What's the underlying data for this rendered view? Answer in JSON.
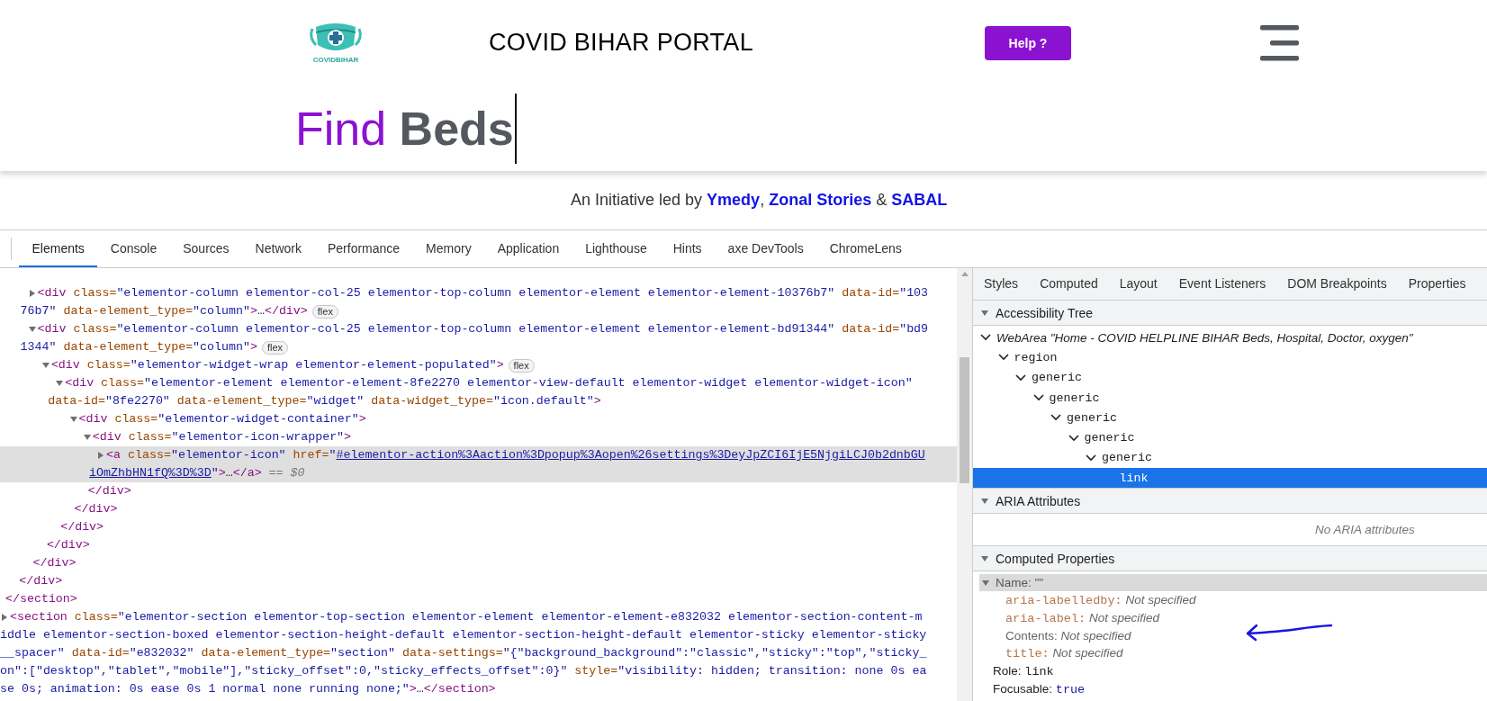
{
  "page": {
    "logo_text": "COVIDBIHAR",
    "title": "COVID BIHAR PORTAL",
    "help_button": "Help ?",
    "heading": [
      {
        "kind": "accent",
        "text": "Find"
      },
      {
        "kind": "main",
        "text": "Beds"
      }
    ],
    "credit": "An Initiative led by **Ymedy**, **Zonal Stories** & **SABAL**"
  },
  "devtools": {
    "tabs": [
      {
        "label": "Elements",
        "selected": true
      },
      {
        "label": "Console",
        "selected": false
      },
      {
        "label": "Sources",
        "selected": false
      },
      {
        "label": "Network",
        "selected": false
      },
      {
        "label": "Performance",
        "selected": false
      },
      {
        "label": "Memory",
        "selected": false
      },
      {
        "label": "Application",
        "selected": false
      },
      {
        "label": "Lighthouse",
        "selected": false
      },
      {
        "label": "Hints",
        "selected": false
      },
      {
        "label": "axe DevTools",
        "selected": false
      },
      {
        "label": "ChromeLens",
        "selected": false
      }
    ],
    "dom_tree": [
      {
        "children": [
          {
            "children": [
              {
                "expanded": false,
                "selected": false,
                "lines": [
                  [
                    {
                      "kind": "tag",
                      "text": "<div"
                    },
                    {
                      "kind": "attr",
                      "text": " class="
                    },
                    {
                      "kind": "value",
                      "text": "\"elementor-column elementor-col-25 elementor-top-column elementor-element elementor-element-10376b7\""
                    },
                    {
                      "kind": "attr",
                      "text": " data-id="
                    },
                    {
                      "kind": "value",
                      "text": "\"103"
                    }
                  ],
                  [
                    {
                      "kind": "value",
                      "text": "76b7\""
                    },
                    {
                      "kind": "attr",
                      "text": " data-element_type="
                    },
                    {
                      "kind": "value",
                      "text": "\"column\""
                    },
                    {
                      "kind": "tag",
                      "text": ">"
                    },
                    {
                      "kind": "text",
                      "text": "…"
                    },
                    {
                      "kind": "tag",
                      "text": "</div>"
                    },
                    {
                      "kind": "badge",
                      "text": "flex"
                    }
                  ]
                ]
              },
              {
                "expanded": true,
                "selected": false,
                "lines": [
                  [
                    {
                      "kind": "tag",
                      "text": "<div"
                    },
                    {
                      "kind": "attr",
                      "text": " class="
                    },
                    {
                      "kind": "value",
                      "text": "\"elementor-column elementor-col-25 elementor-top-column elementor-element elementor-element-bd91344\""
                    },
                    {
                      "kind": "attr",
                      "text": " data-id="
                    },
                    {
                      "kind": "value",
                      "text": "\"bd9"
                    }
                  ],
                  [
                    {
                      "kind": "value",
                      "text": "1344\""
                    },
                    {
                      "kind": "attr",
                      "text": " data-element_type="
                    },
                    {
                      "kind": "value",
                      "text": "\"column\""
                    },
                    {
                      "kind": "tag",
                      "text": ">"
                    },
                    {
                      "kind": "badge",
                      "text": "flex"
                    }
                  ]
                ],
                "children": [
                  {
                    "expanded": true,
                    "selected": false,
                    "lines": [
                      [
                        {
                          "kind": "tag",
                          "text": "<div"
                        },
                        {
                          "kind": "attr",
                          "text": " class="
                        },
                        {
                          "kind": "value",
                          "text": "\"elementor-widget-wrap elementor-element-populated\""
                        },
                        {
                          "kind": "tag",
                          "text": ">"
                        },
                        {
                          "kind": "badge",
                          "text": "flex"
                        }
                      ]
                    ],
                    "children": [
                      {
                        "expanded": true,
                        "selected": false,
                        "lines": [
                          [
                            {
                              "kind": "tag",
                              "text": "<div"
                            },
                            {
                              "kind": "attr",
                              "text": " class="
                            },
                            {
                              "kind": "value",
                              "text": "\"elementor-element elementor-element-8fe2270 elementor-view-default elementor-widget elementor-widget-icon\""
                            }
                          ],
                          [
                            {
                              "kind": "attr",
                              "text": "data-id="
                            },
                            {
                              "kind": "value",
                              "text": "\"8fe2270\""
                            },
                            {
                              "kind": "attr",
                              "text": " data-element_type="
                            },
                            {
                              "kind": "value",
                              "text": "\"widget\""
                            },
                            {
                              "kind": "attr",
                              "text": " data-widget_type="
                            },
                            {
                              "kind": "value",
                              "text": "\"icon.default\""
                            },
                            {
                              "kind": "tag",
                              "text": ">"
                            }
                          ]
                        ],
                        "children": [
                          {
                            "expanded": true,
                            "selected": false,
                            "lines": [
                              [
                                {
                                  "kind": "tag",
                                  "text": "<div"
                                },
                                {
                                  "kind": "attr",
                                  "text": " class="
                                },
                                {
                                  "kind": "value",
                                  "text": "\"elementor-widget-container\""
                                },
                                {
                                  "kind": "tag",
                                  "text": ">"
                                }
                              ]
                            ],
                            "children": [
                              {
                                "expanded": true,
                                "selected": false,
                                "lines": [
                                  [
                                    {
                                      "kind": "tag",
                                      "text": "<div"
                                    },
                                    {
                                      "kind": "attr",
                                      "text": " class="
                                    },
                                    {
                                      "kind": "value",
                                      "text": "\"elementor-icon-wrapper\""
                                    },
                                    {
                                      "kind": "tag",
                                      "text": ">"
                                    }
                                  ]
                                ],
                                "children": [
                                  {
                                    "expanded": false,
                                    "selected": true,
                                    "lines": [
                                      [
                                        {
                                          "kind": "tag",
                                          "text": "<a"
                                        },
                                        {
                                          "kind": "attr",
                                          "text": " class="
                                        },
                                        {
                                          "kind": "value",
                                          "text": "\"elementor-icon\""
                                        },
                                        {
                                          "kind": "attr",
                                          "text": " href="
                                        },
                                        {
                                          "kind": "value",
                                          "text": "\""
                                        },
                                        {
                                          "kind": "link",
                                          "text": "#elementor-action%3Aaction%3Dpopup%3Aopen%26settings%3DeyJpZCI6IjE5NjgiLCJ0b2dnbGU"
                                        }
                                      ],
                                      [
                                        {
                                          "kind": "link",
                                          "text": "iOmZhbHN1fQ%3D%3D"
                                        },
                                        {
                                          "kind": "value",
                                          "text": "\""
                                        },
                                        {
                                          "kind": "tag",
                                          "text": ">"
                                        },
                                        {
                                          "kind": "text",
                                          "text": "…"
                                        },
                                        {
                                          "kind": "tag",
                                          "text": "</a>"
                                        },
                                        {
                                          "kind": "dim",
                                          "text": " == $0"
                                        }
                                      ]
                                    ]
                                  }
                                ],
                                "close": [
                                  {
                                    "kind": "tag",
                                    "text": "</div>"
                                  }
                                ]
                              }
                            ],
                            "close": [
                              {
                                "kind": "tag",
                                "text": "</div>"
                              }
                            ]
                          }
                        ],
                        "close": [
                          {
                            "kind": "tag",
                            "text": "</div>"
                          }
                        ]
                      }
                    ],
                    "close": [
                      {
                        "kind": "tag",
                        "text": "</div>"
                      }
                    ]
                  }
                ],
                "close": [
                  {
                    "kind": "tag",
                    "text": "</div>"
                  }
                ]
              }
            ],
            "close": [
              {
                "kind": "tag",
                "text": "</div>"
              }
            ]
          }
        ],
        "close": [
          {
            "kind": "tag",
            "text": "</section>"
          }
        ]
      },
      {
        "expanded": false,
        "selected": false,
        "lines": [
          [
            {
              "kind": "tag",
              "text": "<section"
            },
            {
              "kind": "attr",
              "text": " class="
            },
            {
              "kind": "value",
              "text": "\"elementor-section elementor-top-section elementor-element elementor-element-e832032 elementor-section-content-m"
            }
          ],
          [
            {
              "kind": "value",
              "text": "iddle elementor-section-boxed elementor-section-height-default elementor-section-height-default elementor-sticky elementor-sticky"
            }
          ],
          [
            {
              "kind": "value",
              "text": "__spacer\""
            },
            {
              "kind": "attr",
              "text": " data-id="
            },
            {
              "kind": "value",
              "text": "\"e832032\""
            },
            {
              "kind": "attr",
              "text": " data-element_type="
            },
            {
              "kind": "value",
              "text": "\"section\""
            },
            {
              "kind": "attr",
              "text": " data-settings="
            },
            {
              "kind": "value",
              "text": "\"{\"background_background\":\"classic\",\"sticky\":\"top\",\"sticky_"
            }
          ],
          [
            {
              "kind": "value",
              "text": "on\":[\"desktop\",\"tablet\",\"mobile\"],\"sticky_offset\":0,\"sticky_effects_offset\":0}\""
            },
            {
              "kind": "attr",
              "text": " style="
            },
            {
              "kind": "value",
              "text": "\"visibility: hidden; transition: none 0s ea"
            }
          ],
          [
            {
              "kind": "value",
              "text": "se 0s; animation: 0s ease 0s 1 normal none running none;\""
            },
            {
              "kind": "tag",
              "text": ">"
            },
            {
              "kind": "text",
              "text": "…"
            },
            {
              "kind": "tag",
              "text": "</section>"
            }
          ]
        ]
      }
    ],
    "sidebar": {
      "tabs": [
        {
          "label": "Styles",
          "selected": false
        },
        {
          "label": "Computed",
          "selected": false
        },
        {
          "label": "Layout",
          "selected": false
        },
        {
          "label": "Event Listeners",
          "selected": false
        },
        {
          "label": "DOM Breakpoints",
          "selected": false
        },
        {
          "label": "Properties",
          "selected": false
        }
      ],
      "accessibility_tree": {
        "title": "Accessibility Tree",
        "expanded": true,
        "nodes": [
          {
            "kind": "root",
            "role": "WebArea",
            "name": "\"Home - COVID HELPLINE BIHAR Beds, Hospital, Doctor, oxygen\"",
            "expanded": true,
            "selected": false,
            "children": [
              {
                "kind": "node",
                "role": "region",
                "expanded": true,
                "selected": false,
                "children": [
                  {
                    "kind": "node",
                    "role": "generic",
                    "expanded": true,
                    "selected": false,
                    "children": [
                      {
                        "kind": "node",
                        "role": "generic",
                        "expanded": true,
                        "selected": false,
                        "children": [
                          {
                            "kind": "node",
                            "role": "generic",
                            "expanded": true,
                            "selected": false,
                            "children": [
                              {
                                "kind": "node",
                                "role": "generic",
                                "expanded": true,
                                "selected": false,
                                "children": [
                                  {
                                    "kind": "node",
                                    "role": "generic",
                                    "expanded": true,
                                    "selected": false,
                                    "children": [
                                      {
                                        "kind": "node",
                                        "role": "link",
                                        "selected": true
                                      }
                                    ]
                                  }
                                ]
                              }
                            ]
                          }
                        ]
                      }
                    ]
                  }
                ]
              }
            ]
          }
        ]
      },
      "aria_attributes": {
        "title": "ARIA Attributes",
        "expanded": true,
        "empty_message": "No ARIA attributes"
      },
      "computed_properties": {
        "title": "Computed Properties",
        "expanded": true,
        "name": {
          "label": "Name:",
          "value": "\"\"",
          "expanded": true
        },
        "sources": [
          {
            "kind": "attribute",
            "key": "aria-labelledby:",
            "value": "Not specified"
          },
          {
            "kind": "attribute",
            "key": "aria-label:",
            "value": "Not specified"
          },
          {
            "kind": "content",
            "key": "Contents:",
            "value": "Not specified"
          },
          {
            "kind": "attribute",
            "key": "title:",
            "value": "Not specified"
          }
        ],
        "properties": [
          {
            "kind": "text",
            "label": "Role:",
            "value": "link"
          },
          {
            "kind": "boolean",
            "label": "Focusable:",
            "value": "true"
          }
        ]
      }
    }
  }
}
